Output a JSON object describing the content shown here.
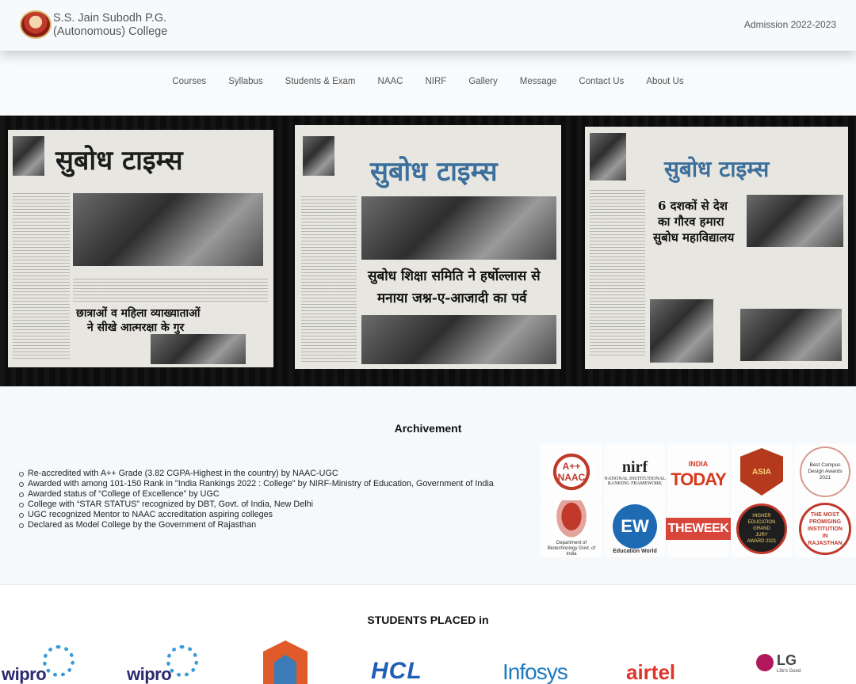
{
  "header": {
    "college_name_line1": "S.S. Jain Subodh P.G.",
    "college_name_line2": "(Autonomous) College",
    "admission_label": "Admission 2022-2023"
  },
  "nav": {
    "items": [
      "Courses",
      "Syllabus",
      "Students & Exam",
      "NAAC",
      "NIRF",
      "Gallery",
      "Message",
      "Contact Us",
      "About Us"
    ]
  },
  "hero": {
    "newspapers": [
      {
        "masthead": "सुबोध टाइम्स",
        "headline1": "छात्राओं व महिला व्याख्याताओं",
        "headline2": "ने सीखे आत्मरक्षा के गुर"
      },
      {
        "masthead": "सुबोध टाइम्स",
        "headline1": "सुबोध शिक्षा समिति ने हर्षोल्लास से",
        "headline2": "मनाया जश्न-ए-आजादी का पर्व"
      },
      {
        "masthead": "सुबोध टाइम्स",
        "headline1": "6 दशकों से देश",
        "headline2": "का गौरव हमारा",
        "headline3": "सुबोध महाविद्यालय"
      }
    ]
  },
  "achievement": {
    "title": "Archivement",
    "items": [
      "Re-accredited with A++ Grade (3.82 CGPA-Highest in the country) by NAAC-UGC",
      "Awarded with among 101-150 Rank in \"India Rankings 2022 : College\" by NIRF-Ministry of Education, Government of India",
      "Awarded status of “College of Excellence” by UGC",
      "College with “STAR STATUS” recognized by DBT, Govt. of India, New Delhi",
      "UGC recognized Mentor to NAAC accreditation aspiring colleges",
      "Declared as Model College by the Government of Rajasthan"
    ],
    "badges": {
      "naac": "A++ NAAC",
      "nirf": "nirf",
      "nirf_sub": "NATIONAL INSTITUTIONAL RANKING FRAMEWORK",
      "india_today_top": "INDIA",
      "india_today": "TODAY",
      "asia": "ASIA",
      "campus": "Best Campus Design Awards 2021",
      "dbt": "Department of Biotechnology Govt. of India",
      "ew": "EW",
      "ew_sub": "Education World",
      "week": "THEWEEK",
      "higher_ed": "HIGHER EDUCATION GRAND JURY AWARD 2021",
      "promising": "THE MOST PROMISING INSTITUTION IN RAJASTHAN"
    }
  },
  "placed": {
    "title": "STUDENTS PLACED in",
    "logos": [
      "wipro",
      "wipro",
      "",
      "HCL",
      "Infosys",
      "airtel",
      "LG"
    ],
    "lg_tagline": "Life's Good"
  },
  "colors": {
    "accent_red": "#c0392b",
    "text_gray": "#555555",
    "header_bg": "#f7fafd"
  }
}
